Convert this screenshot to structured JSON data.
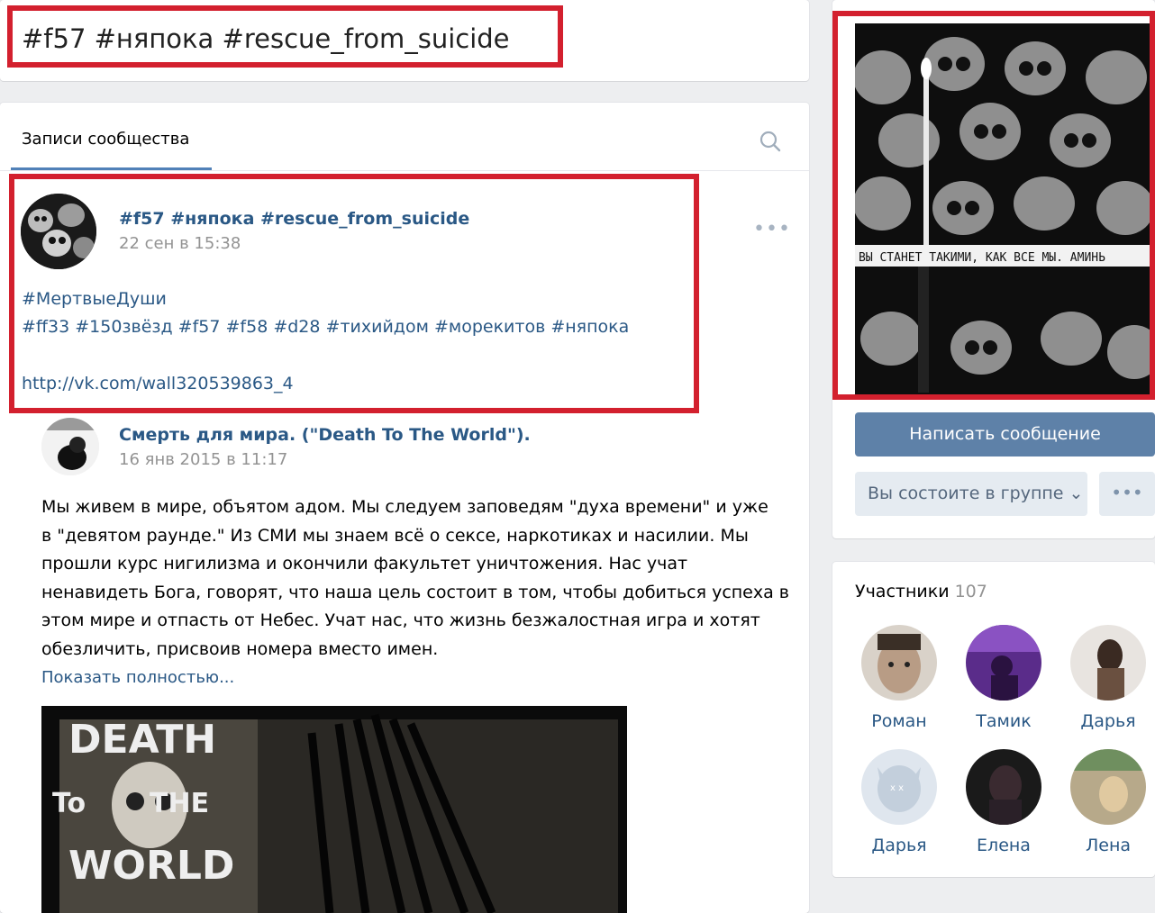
{
  "group": {
    "title": "#f57 #няпока #rescue_from_suicide"
  },
  "wall": {
    "tab_label": "Записи сообщества",
    "search_icon": "search-icon",
    "post": {
      "author": "#f57 #няпока #rescue_from_suicide",
      "date": "22 сен в 15:38",
      "hashtag_line1": "#МертвыеДуши",
      "hashtag_line2": "#ff33 #150звёзд #f57 #f58 #d28 #тихийдом #морекитов #няпока",
      "link": "http://vk.com/wall320539863_4",
      "menu_icon": "more-dots-icon"
    },
    "repost": {
      "author": "Смерть для мира. (\"Death To The World\").",
      "date": "16 янв 2015 в 11:17",
      "text_lines": [
        "Мы живем в мире, объятом адом. Мы следуем заповедям \"духа времени\" и уже",
        "в \"девятом раунде.\" Из СМИ мы знаем всё о сексе, наркотиках и насилии. Мы",
        "прошли курс нигилизма и окончили факультет уничтожения. Нас учат",
        "ненавидеть Бога, говорят, что наша цель состоит в том, чтобы добиться успеха в",
        "этом мире и отпасть от Небес. Учат нас, что жизнь безжалостная игра и хотят",
        "обезличить, присвоив номера вместо имен."
      ],
      "show_more": "Показать полностью...",
      "image_text": {
        "line1": "DEATH",
        "line2a": "To",
        "line2b": "THE",
        "line3": "WORLD"
      }
    }
  },
  "sidebar": {
    "cover_caption": "ВЫ СТАНЕТ  ТАКИМИ, КАК ВСЕ МЫ. АМИНЬ",
    "message_button": "Написать сообщение",
    "member_button": "Вы состоите в группе ⌄",
    "more_button": "•••",
    "members": {
      "title": "Участники",
      "count": "107",
      "list": [
        {
          "name": "Роман"
        },
        {
          "name": "Тамик"
        },
        {
          "name": "Дарья"
        },
        {
          "name": "Дарья"
        },
        {
          "name": "Елена"
        },
        {
          "name": "Лена"
        }
      ]
    }
  },
  "colors": {
    "highlight": "#d3202e",
    "link": "#2a5885",
    "button": "#5e81a8"
  }
}
